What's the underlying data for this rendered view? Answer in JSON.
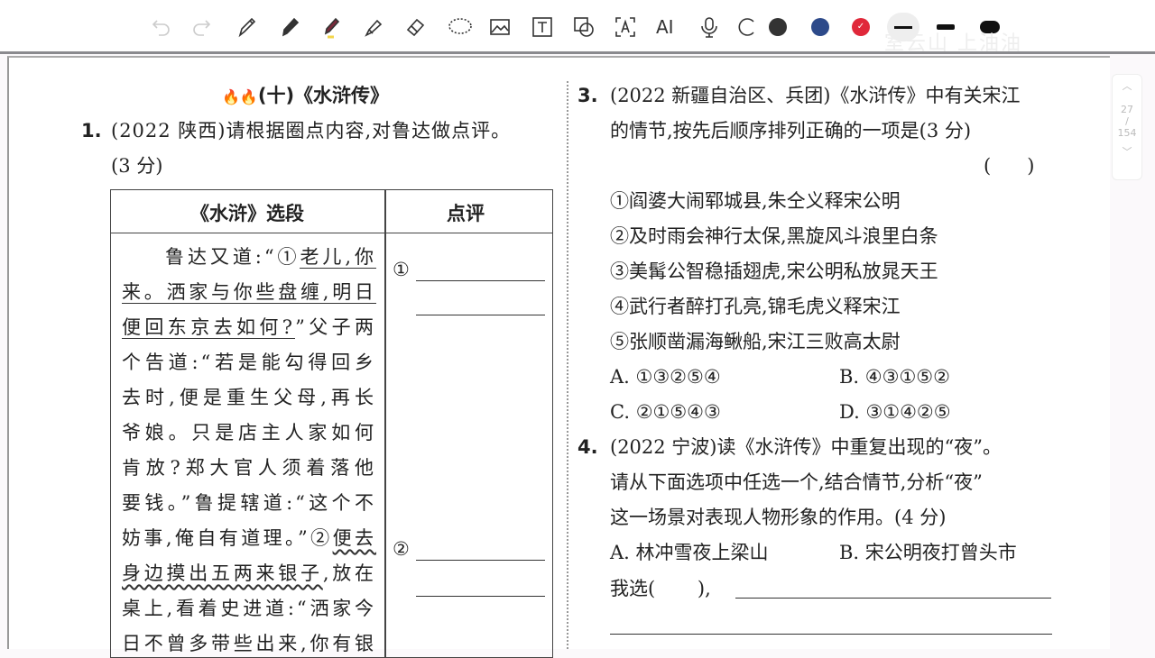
{
  "toolbar": {
    "tools": [
      "undo-icon",
      "redo-icon",
      "pen-icon",
      "pencil-icon",
      "marker-icon",
      "highlighter-icon",
      "eraser-icon",
      "lasso-icon",
      "image-icon",
      "text-box-icon",
      "shape-icon",
      "ocr-icon",
      "ai-icon",
      "microphone-icon",
      "more-icon"
    ],
    "ai_label": "AI",
    "colors": [
      "#333333",
      "#2d4a8a",
      "#e0283a"
    ],
    "watermark": "室云山 上油油"
  },
  "pager": {
    "current": "27",
    "sep": "/",
    "total": "154"
  },
  "left": {
    "section_title": "(十)《水浒传》",
    "q1_num": "1.",
    "q1_line1": "(2022 陕西)请根据圈点内容,对鲁达做点评。",
    "q1_line2": "(3 分)",
    "table": {
      "col1": "《水浒》选段",
      "col2": "点评",
      "marker1": "①",
      "marker2": "②",
      "passage": [
        [
          {
            "t": "鲁达又道:“①"
          },
          {
            "t": "老儿,你",
            "s": "u"
          }
        ],
        [
          {
            "t": "来。洒家与你些盘缠,明日",
            "s": "u"
          }
        ],
        [
          {
            "t": "便回东京去如何?",
            "s": "u"
          },
          {
            "t": "”父子两"
          }
        ],
        [
          {
            "t": "个告道:“若是能勾得回乡"
          }
        ],
        [
          {
            "t": "去时,便是重生父母,再长"
          }
        ],
        [
          {
            "t": "爷娘。只是店主人家如何"
          }
        ],
        [
          {
            "t": "肯放?郑大官人须着落他"
          }
        ],
        [
          {
            "t": "要钱。”鲁提辖道:“这个不"
          }
        ],
        [
          {
            "t": "妨事,俺自有道理。”②"
          },
          {
            "t": "便去",
            "s": "w"
          }
        ],
        [
          {
            "t": "身边摸出五两来银子",
            "s": "w"
          },
          {
            "t": ",放在"
          }
        ],
        [
          {
            "t": "桌上,看着史进道:“洒家今"
          }
        ],
        [
          {
            "t": "日不曾多带些出来,你有银"
          }
        ]
      ]
    }
  },
  "right": {
    "q3_num": "3.",
    "q3_line1": "(2022 新疆自治区、兵团)《水浒传》中有关宋江",
    "q3_line2": "的情节,按先后顺序排列正确的一项是(3 分)",
    "q3_paren": "(      )",
    "items": [
      "①阎婆大闹郓城县,朱仝义释宋公明",
      "②及时雨会神行太保,黑旋风斗浪里白条",
      "③美髯公智稳插翅虎,宋公明私放晁天王",
      "④武行者醉打孔亮,锦毛虎义释宋江",
      "⑤张顺凿漏海鳅船,宋江三败高太尉"
    ],
    "options": [
      {
        "label": "A.",
        "value": "①③②⑤④"
      },
      {
        "label": "B.",
        "value": "④③①⑤②"
      },
      {
        "label": "C.",
        "value": "②①⑤④③"
      },
      {
        "label": "D.",
        "value": "③①④②⑤"
      }
    ],
    "q4_num": "4.",
    "q4_line1": "(2022 宁波)读《水浒传》中重复出现的“夜”。",
    "q4_line2": "请从下面选项中任选一个,结合情节,分析“夜”",
    "q4_line3": "这一场景对表现人物形象的作用。(4 分)",
    "q4_optA": "A. 林冲雪夜上梁山",
    "q4_optB": "B. 宋公明夜打曾头市",
    "q4_choose": "我选(       ),"
  }
}
